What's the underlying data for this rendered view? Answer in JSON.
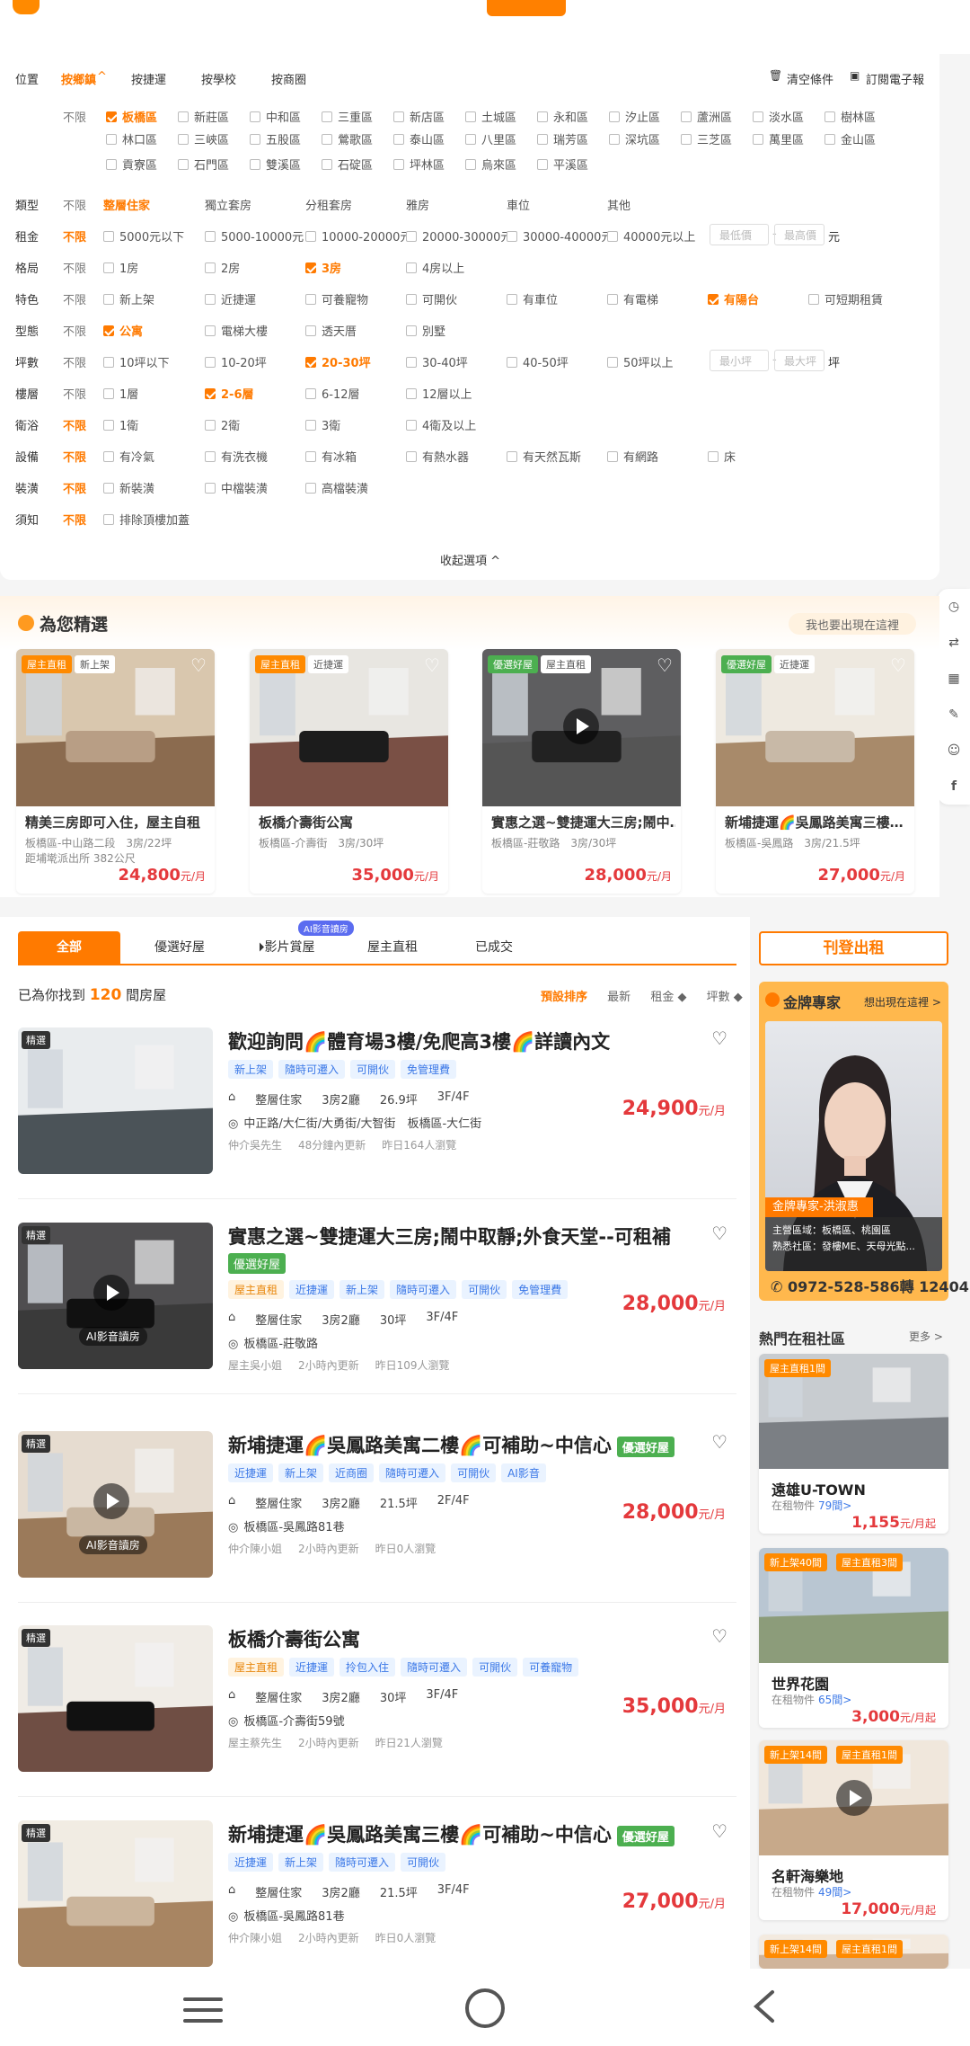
{
  "filters": {
    "location_label": "位置",
    "tabs": [
      "按鄉鎮",
      "按捷運",
      "按學校",
      "按商圈"
    ],
    "clear": "清空條件",
    "subscribe": "訂閱電子報",
    "no_limit": "不限",
    "districts_row1": [
      "板橋區",
      "新莊區",
      "中和區",
      "三重區",
      "新店區",
      "土城區",
      "永和區",
      "汐止區",
      "蘆洲區",
      "淡水區",
      "樹林區"
    ],
    "districts_row2": [
      "林口區",
      "三峽區",
      "五股區",
      "鶯歌區",
      "泰山區",
      "八里區",
      "瑞芳區",
      "深坑區",
      "三芝區",
      "萬里區",
      "金山區"
    ],
    "districts_row3": [
      "貢寮區",
      "石門區",
      "雙溪區",
      "石碇區",
      "坪林區",
      "烏來區",
      "平溪區"
    ],
    "type": {
      "label": "類型",
      "options": [
        "整層住家",
        "獨立套房",
        "分租套房",
        "雅房",
        "車位",
        "其他"
      ]
    },
    "rent": {
      "label": "租金",
      "options": [
        "5000元以下",
        "5000-10000元",
        "10000-20000元",
        "20000-30000元",
        "30000-40000元",
        "40000元以上"
      ],
      "min": "最低價",
      "max": "最高價",
      "unit": "元"
    },
    "layout": {
      "label": "格局",
      "options": [
        "1房",
        "2房",
        "3房",
        "4房以上"
      ]
    },
    "feature": {
      "label": "特色",
      "options": [
        "新上架",
        "近捷運",
        "可養寵物",
        "可開伙",
        "有車位",
        "有電梯",
        "有陽台",
        "可短期租賃"
      ]
    },
    "shape": {
      "label": "型態",
      "options": [
        "公寓",
        "電梯大樓",
        "透天厝",
        "別墅"
      ]
    },
    "ping": {
      "label": "坪數",
      "options": [
        "10坪以下",
        "10-20坪",
        "20-30坪",
        "30-40坪",
        "40-50坪",
        "50坪以上"
      ],
      "min": "最小坪",
      "max": "最大坪",
      "unit": "坪"
    },
    "floor": {
      "label": "樓層",
      "options": [
        "1層",
        "2-6層",
        "6-12層",
        "12層以上"
      ]
    },
    "bath": {
      "label": "衛浴",
      "options": [
        "1衛",
        "2衛",
        "3衛",
        "4衛及以上"
      ]
    },
    "equip": {
      "label": "設備",
      "options": [
        "有冷氣",
        "有洗衣機",
        "有冰箱",
        "有熱水器",
        "有天然瓦斯",
        "有網路",
        "床"
      ]
    },
    "decor": {
      "label": "裝潢",
      "options": [
        "新裝潢",
        "中檔裝潢",
        "高檔裝潢"
      ]
    },
    "notice": {
      "label": "須知",
      "options": [
        "排除頂樓加蓋"
      ]
    },
    "collapse": "收起選項 ^"
  },
  "recommend": {
    "title": "為您精選",
    "badge": "我也要出現在這裡",
    "cards": [
      {
        "tags": [
          "屋主直租",
          "新上架"
        ],
        "title": "精美三房即可入住，屋主自租",
        "sub": "板橋區-中山路二段　3房/22坪",
        "sub2": "距埔墘派出所 382公尺",
        "price": "24,800",
        "unit": "元/月"
      },
      {
        "tags": [
          "屋主直租",
          "近捷運"
        ],
        "title": "板橋介壽街公寓",
        "sub": "板橋區-介壽街　3房/30坪",
        "sub2": "",
        "price": "35,000",
        "unit": "元/月"
      },
      {
        "tags": [
          "優選好屋",
          "屋主直租"
        ],
        "title": "實惠之選~雙捷運大三房;鬧中…",
        "sub": "板橋區-莊敬路　3房/30坪",
        "sub2": "",
        "price": "28,000",
        "unit": "元/月"
      },
      {
        "tags": [
          "優選好屋",
          "近捷運"
        ],
        "title": "新埔捷運🌈吳鳳路美寓三樓…",
        "sub": "板橋區-吳鳳路　3房/21.5坪",
        "sub2": "",
        "price": "27,000",
        "unit": "元/月"
      }
    ]
  },
  "tabs": {
    "items": [
      "全部",
      "優選好屋",
      "影片賞屋",
      "屋主直租",
      "已成交"
    ],
    "ai": "AI影音讀房"
  },
  "results": {
    "prefix": "已為你找到",
    "count": "120",
    "suffix": "間房屋",
    "sorts": [
      "預設排序",
      "最新",
      "租金 ◆",
      "坪數 ◆"
    ]
  },
  "listings": [
    {
      "title": "歡迎詢問🌈體育場3樓/免爬高3樓🌈詳讀內文",
      "tags": [
        "新上架",
        "隨時可遷入",
        "可開伙",
        "免管理費"
      ],
      "own": false,
      "type": "整層住家",
      "rooms": "3房2廳",
      "size": "26.9坪",
      "floor": "3F/4F",
      "addr": "中正路/大仁街/大勇街/大智街　板橋區-大仁街",
      "agent": "仲介吳先生",
      "updated": "48分鐘內更新",
      "views": "昨日164人瀏覽",
      "price": "24,900",
      "unit": "元/月"
    },
    {
      "title": "實惠之選~雙捷運大三房;鬧中取靜;外食天堂--可租補",
      "badge": "優選好屋",
      "tags": [
        "屋主直租",
        "近捷運",
        "新上架",
        "隨時可遷入",
        "可開伙",
        "免管理費"
      ],
      "own": true,
      "type": "整層住家",
      "rooms": "3房2廳",
      "size": "30坪",
      "floor": "3F/4F",
      "addr": "板橋區-莊敬路",
      "agent": "屋主吳小姐",
      "updated": "2小時內更新",
      "views": "昨日109人瀏覽",
      "price": "28,000",
      "unit": "元/月"
    },
    {
      "title": "新埔捷運🌈吳鳳路美寓二樓🌈可補助~中信心",
      "badge": "優選好屋",
      "tags": [
        "近捷運",
        "新上架",
        "近商圈",
        "隨時可遷入",
        "可開伙",
        "AI影音"
      ],
      "own": false,
      "type": "整層住家",
      "rooms": "3房2廳",
      "size": "21.5坪",
      "floor": "2F/4F",
      "addr": "板橋區-吳鳳路81巷",
      "agent": "仲介陳小姐",
      "updated": "2小時內更新",
      "views": "昨日0人瀏覽",
      "price": "28,000",
      "unit": "元/月"
    },
    {
      "title": "板橋介壽街公寓",
      "tags": [
        "屋主直租",
        "近捷運",
        "拎包入住",
        "隨時可遷入",
        "可開伙",
        "可養寵物"
      ],
      "own": true,
      "type": "整層住家",
      "rooms": "3房2廳",
      "size": "30坪",
      "floor": "3F/4F",
      "addr": "板橋區-介壽街59號",
      "agent": "屋主蔡先生",
      "updated": "2小時內更新",
      "views": "昨日21人瀏覽",
      "price": "35,000",
      "unit": "元/月"
    },
    {
      "title": "新埔捷運🌈吳鳳路美寓三樓🌈可補助~中信心",
      "badge": "優選好屋",
      "tags": [
        "近捷運",
        "新上架",
        "隨時可遷入",
        "可開伙"
      ],
      "own": false,
      "type": "整層住家",
      "rooms": "3房2廳",
      "size": "21.5坪",
      "floor": "3F/4F",
      "addr": "板橋區-吳鳳路81巷",
      "agent": "仲介陳小姐",
      "updated": "2小時內更新",
      "views": "昨日0人瀏覽",
      "price": "27,000",
      "unit": "元/月"
    }
  ],
  "selected_badge": "精選",
  "ai_video": "AI影音讀房",
  "sidebar": {
    "publish": "刊登出租",
    "expert_title": "金牌專家",
    "expert_want": "想出現在這裡 >",
    "expert_name": "金牌專家-洪淑惠",
    "expert_area": "主營區域：板橋區、桃園區",
    "expert_comm": "熟悉社區：發樓ME、天母光點...",
    "phone": "0972-528-586轉 12404",
    "hot_title": "熱門在租社區",
    "hot_more": "更多 >",
    "hot": [
      {
        "tags": [
          "屋主直租1間"
        ],
        "name": "遠雄U-TOWN",
        "count_label": "在租物件",
        "count": "79間>",
        "price": "1,155",
        "unit": "元/月起"
      },
      {
        "tags": [
          "新上架40間",
          "屋主直租3間"
        ],
        "name": "世界花園",
        "count_label": "在租物件",
        "count": "65間>",
        "price": "3,000",
        "unit": "元/月起"
      },
      {
        "tags": [
          "新上架14間",
          "屋主直租1間"
        ],
        "name": "名軒海樂地",
        "count_label": "在租物件",
        "count": "49間>",
        "price": "17,000",
        "unit": "元/月起"
      },
      {
        "tags": [
          "新上架14間",
          "屋主直租1間"
        ],
        "name": "",
        "count_label": "",
        "count": "",
        "price": "",
        "unit": ""
      }
    ]
  }
}
